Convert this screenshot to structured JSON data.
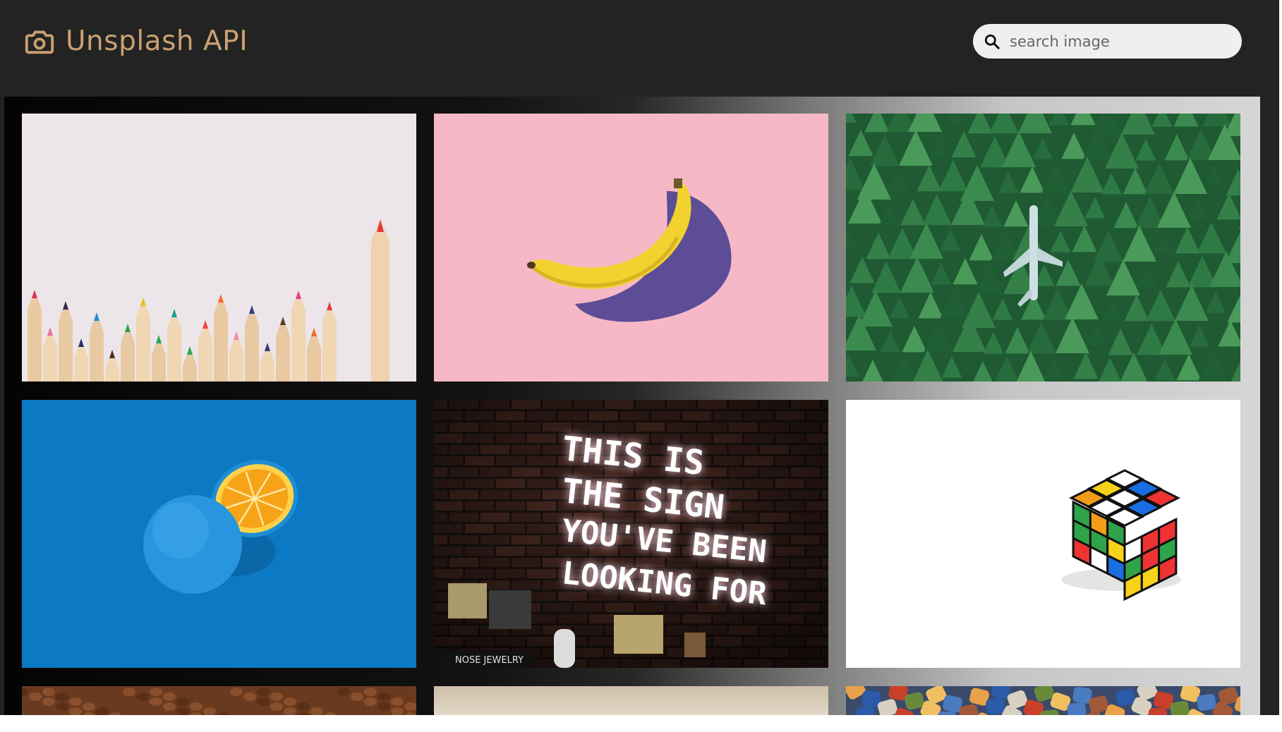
{
  "app": {
    "title": "Unsplash API"
  },
  "search": {
    "placeholder": "search image",
    "value": ""
  },
  "icons": {
    "brand": "camera-icon",
    "search": "search-icon"
  },
  "colors": {
    "header_bg": "#232323",
    "brand": "#c9a172",
    "search_bg": "#efefef"
  },
  "gallery": {
    "photos": [
      {
        "name": "colored-pencils",
        "sign_lines": []
      },
      {
        "name": "banana-on-pink",
        "sign_lines": []
      },
      {
        "name": "plane-in-forest",
        "sign_lines": []
      },
      {
        "name": "blue-orange",
        "sign_lines": []
      },
      {
        "name": "neon-sign",
        "sign_lines": [
          "THIS IS",
          "THE SIGN",
          "YOU'VE BEEN",
          "LOOKING FOR"
        ],
        "shop_sign": "NOSE JEWELRY"
      },
      {
        "name": "rubiks-cube",
        "sign_lines": []
      },
      {
        "name": "coffee-beans",
        "sign_lines": []
      },
      {
        "name": "beige-surface",
        "sign_lines": []
      },
      {
        "name": "puzzle-pieces",
        "sign_lines": []
      }
    ]
  }
}
